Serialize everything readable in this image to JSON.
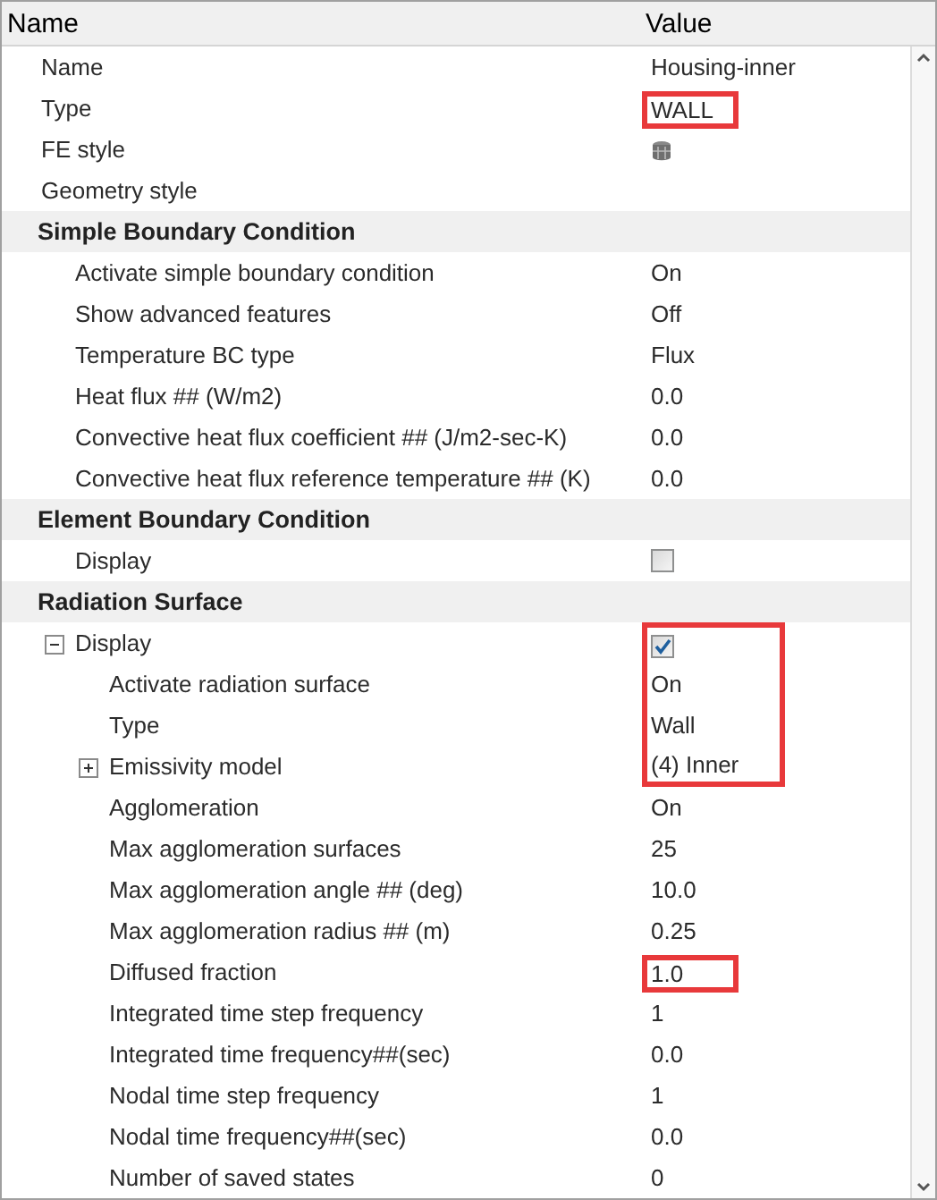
{
  "header": {
    "name": "Name",
    "value": "Value"
  },
  "rows": [
    {
      "kind": "text",
      "label": "Name",
      "value": "Housing-inner",
      "highlighted": false
    },
    {
      "kind": "text",
      "label": "Type",
      "value": "WALL",
      "highlighted": true
    },
    {
      "kind": "icon",
      "label": "FE style",
      "highlighted": false
    },
    {
      "kind": "text",
      "label": "Geometry style",
      "highlighted": false
    }
  ],
  "sections": [
    {
      "title": "Simple Boundary Condition",
      "rows": [
        {
          "kind": "text",
          "label": "Activate simple boundary condition",
          "value": "On",
          "highlighted": false
        },
        {
          "kind": "text",
          "label": "Show advanced features",
          "value": "Off",
          "highlighted": false
        },
        {
          "kind": "text",
          "label": "Temperature BC type",
          "value": "Flux",
          "highlighted": false
        },
        {
          "kind": "text",
          "label": "Heat flux ## (W/m2)",
          "value": "0.0",
          "highlighted": false
        },
        {
          "kind": "text",
          "label": "Convective heat flux coefficient ## (J/m2-sec-K)",
          "value": "0.0",
          "highlighted": false
        },
        {
          "kind": "text",
          "label": "Convective heat flux reference temperature ## (K)",
          "value": "0.0",
          "highlighted": false
        }
      ]
    },
    {
      "title": "Element Boundary Condition",
      "rows": [
        {
          "kind": "checkbox",
          "label": "Display",
          "checked": false,
          "highlighted": false
        }
      ]
    },
    {
      "title": "Radiation Surface",
      "rows": [
        {
          "kind": "checkbox",
          "label": "Display",
          "checked": true,
          "highlighted": true,
          "expanded": true,
          "children": [
            {
              "kind": "text",
              "label": "Activate radiation surface",
              "value": "On",
              "highlighted": true
            },
            {
              "kind": "text",
              "label": "Type",
              "value": "Wall",
              "highlighted": true
            },
            {
              "kind": "text",
              "label": "Emissivity model",
              "value": "(4) Inner",
              "highlighted": true,
              "expanded": false
            },
            {
              "kind": "text",
              "label": "Agglomeration",
              "value": "On",
              "highlighted": false
            },
            {
              "kind": "text",
              "label": "Max agglomeration surfaces",
              "value": "25",
              "highlighted": false
            },
            {
              "kind": "text",
              "label": "Max agglomeration angle ## (deg)",
              "value": "10.0",
              "highlighted": false
            },
            {
              "kind": "text",
              "label": "Max agglomeration radius ## (m)",
              "value": "0.25",
              "highlighted": false
            },
            {
              "kind": "text",
              "label": "Diffused fraction",
              "value": "1.0",
              "highlighted": true
            },
            {
              "kind": "text",
              "label": "Integrated time step frequency",
              "value": "1",
              "highlighted": false
            },
            {
              "kind": "text",
              "label": "Integrated time frequency##(sec)",
              "value": "0.0",
              "highlighted": false
            },
            {
              "kind": "text",
              "label": "Nodal time step frequency",
              "value": "1",
              "highlighted": false
            },
            {
              "kind": "text",
              "label": "Nodal time frequency##(sec)",
              "value": "0.0",
              "highlighted": false
            },
            {
              "kind": "text",
              "label": "Number of saved states",
              "value": "0",
              "highlighted": false
            }
          ]
        }
      ]
    }
  ]
}
